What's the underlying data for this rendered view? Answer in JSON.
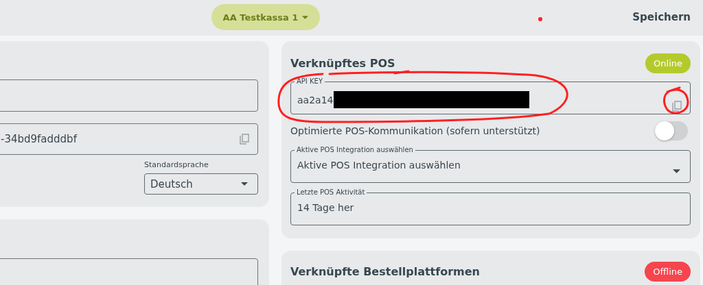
{
  "top_bar": {
    "register_selector": "AA Testkassa 1",
    "save_button": "Speichern"
  },
  "left_panel": {
    "field_2": {
      "value": "-34bd9fadddbf"
    },
    "language": {
      "label": "Standardsprache",
      "value": "Deutsch"
    }
  },
  "pos_panel": {
    "title": "Verknüpftes POS",
    "status": {
      "label": "Online",
      "kind": "online"
    },
    "api_key": {
      "label": "API KEY",
      "value": "aa2a14"
    },
    "optimized_toggle": {
      "label": "Optimierte POS-Kommunikation (sofern unterstützt)",
      "on": false
    },
    "integration_select": {
      "label": "Aktive POS Integration auswählen",
      "value": "Aktive POS Integration auswählen"
    },
    "last_activity": {
      "label": "Letzte POS Aktivität",
      "value": "14 Tage her"
    }
  },
  "platforms_panel": {
    "title": "Verknüpfte Bestellplattformen",
    "status": {
      "label": "Offline",
      "kind": "offline"
    }
  }
}
